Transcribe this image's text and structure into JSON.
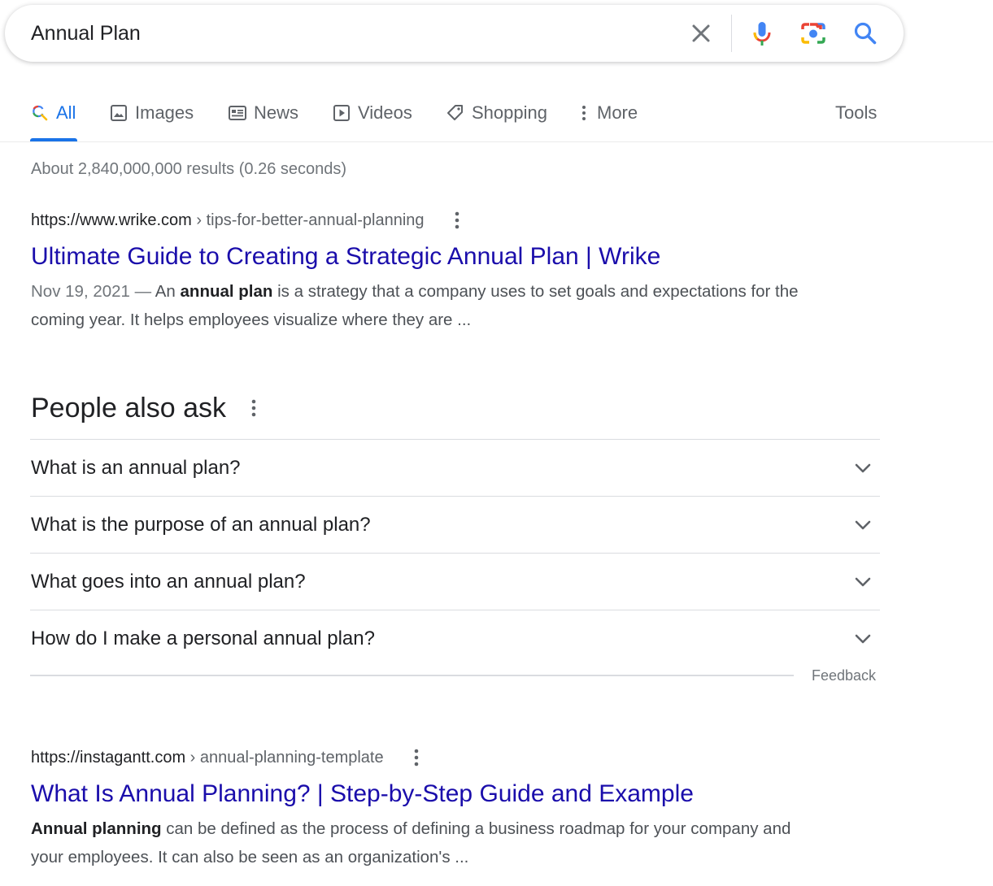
{
  "search": {
    "query": "Annual Plan"
  },
  "icons": {
    "clear": "close-icon",
    "voice": "microphone-icon",
    "lens": "camera-icon",
    "search": "search-icon"
  },
  "colors": {
    "accent": "#1a73e8",
    "link": "#1a0dab",
    "google_blue": "#4285f4",
    "google_red": "#ea4335",
    "google_yellow": "#fbbc04",
    "google_green": "#34a853"
  },
  "tabs": [
    {
      "label": "All",
      "icon": "search-icon",
      "active": true
    },
    {
      "label": "Images",
      "icon": "image-icon"
    },
    {
      "label": "News",
      "icon": "news-icon"
    },
    {
      "label": "Videos",
      "icon": "video-icon"
    },
    {
      "label": "Shopping",
      "icon": "tag-icon"
    },
    {
      "label": "More",
      "icon": "more-vert-icon"
    }
  ],
  "tools_label": "Tools",
  "result_stats": "About 2,840,000,000 results (0.26 seconds)",
  "results": [
    {
      "url": "https://www.wrike.com",
      "breadcrumb": "› tips-for-better-annual-planning",
      "title": "Ultimate Guide to Creating a Strategic Annual Plan | Wrike",
      "date": "Nov 19, 2021 —",
      "snippet_pre": "An",
      "snippet_bold": "annual plan",
      "snippet_post": "is a strategy that a company uses to set goals and expectations for the coming year. It helps employees visualize where they are ..."
    },
    {
      "url": "https://instagantt.com",
      "breadcrumb": "› annual-planning-template",
      "title": "What Is Annual Planning? | Step-by-Step Guide and Example",
      "snippet_bold": "Annual planning",
      "snippet_post": "can be defined as the process of defining a business roadmap for your company and your employees. It can also be seen as an organization's ..."
    }
  ],
  "people_also_ask": {
    "heading": "People also ask",
    "questions": [
      "What is an annual plan?",
      "What is the purpose of an annual plan?",
      "What goes into an annual plan?",
      "How do I make a personal annual plan?"
    ],
    "feedback": "Feedback"
  }
}
